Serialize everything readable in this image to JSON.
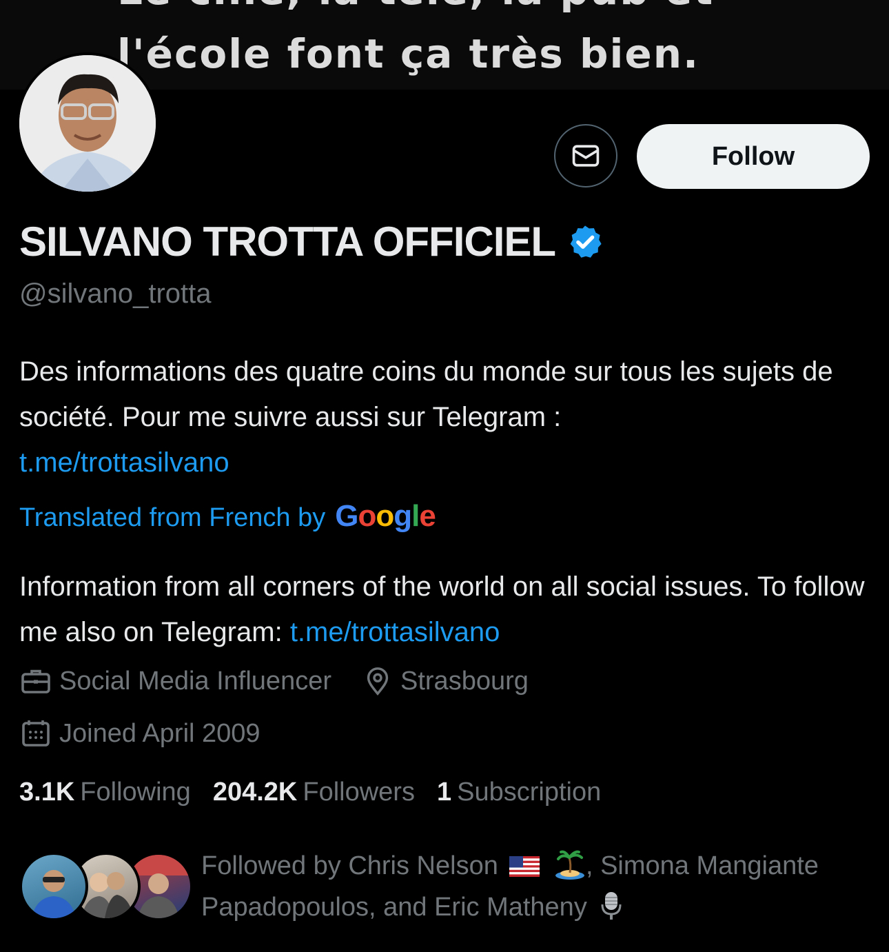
{
  "banner": {
    "line1": "Le cine, la tele, la pub et",
    "line2": "l'école font ça très bien."
  },
  "profile": {
    "display_name": "SILVANO TROTTA OFFICIEL",
    "handle": "@silvano_trotta",
    "verified": true,
    "follow_label": "Follow",
    "message_icon": "envelope-icon"
  },
  "bio": {
    "text": "Des informations des quatre coins du monde sur tous les sujets de société. Pour me suivre aussi sur Telegram :",
    "link": "t.me/trottasilvano"
  },
  "translation": {
    "label": "Translated from French by",
    "provider": "Google",
    "text": "Information from all corners of the world on all social issues. To follow me also on Telegram:",
    "link": "t.me/trottasilvano"
  },
  "meta": {
    "profession": "Social Media Influencer",
    "location": "Strasbourg",
    "joined": "Joined April 2009"
  },
  "stats": {
    "following_count": "3.1K",
    "following_label": "Following",
    "followers_count": "204.2K",
    "followers_label": "Followers",
    "subscription_count": "1",
    "subscription_label": "Subscription"
  },
  "followed_by": {
    "text_a": "Followed by Chris Nelson",
    "text_b": ", Simona Mangiante Papadopoulos, and Eric Matheny"
  },
  "colors": {
    "link": "#1d9bf0",
    "muted": "#71767b",
    "text": "#e7e9ea",
    "background": "#000000"
  }
}
